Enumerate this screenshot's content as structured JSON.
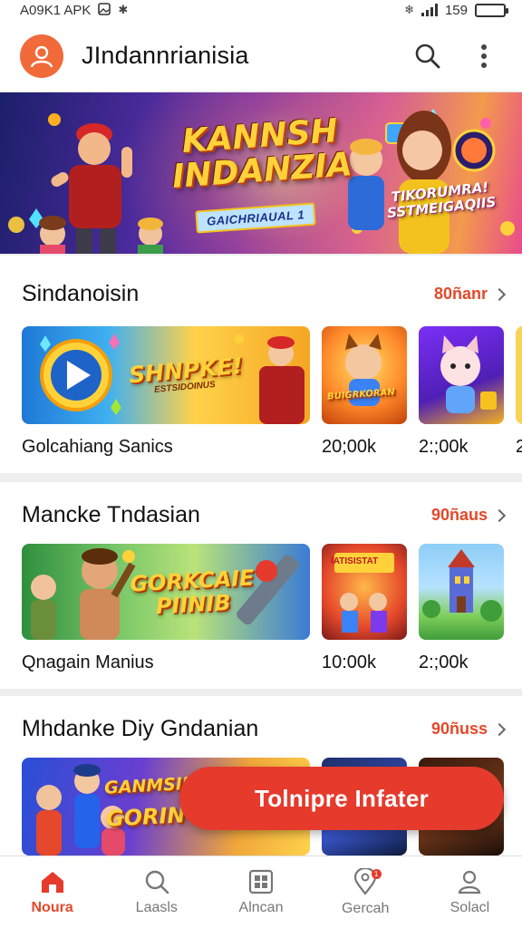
{
  "status_bar": {
    "left_text": "A09K1 APK",
    "battery_percent": "159",
    "battery_level": 0.9
  },
  "app_bar": {
    "title": "JIndannrianisia"
  },
  "hero": {
    "title_line1": "KANNSH",
    "title_line2": "INDANZIA",
    "subtitle": "GAICHRIAUAL 1",
    "tag_line1": "TIKORUMRA!",
    "tag_line2": "SSTMEIGAQIIS"
  },
  "sections": [
    {
      "title": "Sindanoisin",
      "see_all": "80ñanr",
      "banner_text": "SHNPKE!",
      "banner_sub": "ESTSIDOINUS",
      "thumb_text": "BUIGRKORAN",
      "items": [
        {
          "label": "Golcahiang Sanics"
        },
        {
          "label": "20;00k"
        },
        {
          "label": "2:;00k"
        },
        {
          "label": "2"
        }
      ]
    },
    {
      "title": "Mancke Tndasian",
      "see_all": "90ñaus",
      "banner_text_1": "GORKCAIE",
      "banner_text_2": "PIINIB",
      "thumb_text": "IATISISTAT",
      "items": [
        {
          "label": "Qnagain Manius"
        },
        {
          "label": "10:00k"
        },
        {
          "label": "2:;00k"
        }
      ]
    },
    {
      "title": "Mhdanke Diy Gndanian",
      "see_all": "90ñuss",
      "banner_text_1": "GANMSIIE",
      "banner_text_2": "GORIN"
    }
  ],
  "fab": {
    "label": "Tolnipre Infater"
  },
  "bottom_nav": [
    {
      "label": "Noura",
      "icon": "home-icon",
      "active": true
    },
    {
      "label": "Laasls",
      "icon": "search-icon",
      "active": false
    },
    {
      "label": "Alncan",
      "icon": "grid-icon",
      "active": false
    },
    {
      "label": "Gercah",
      "icon": "location-pin-icon",
      "active": false,
      "badge": "1"
    },
    {
      "label": "Solacl",
      "icon": "user-icon",
      "active": false
    }
  ],
  "colors": {
    "accent": "#e53a2c",
    "avatar": "#f06a3a",
    "link": "#e4482a"
  }
}
